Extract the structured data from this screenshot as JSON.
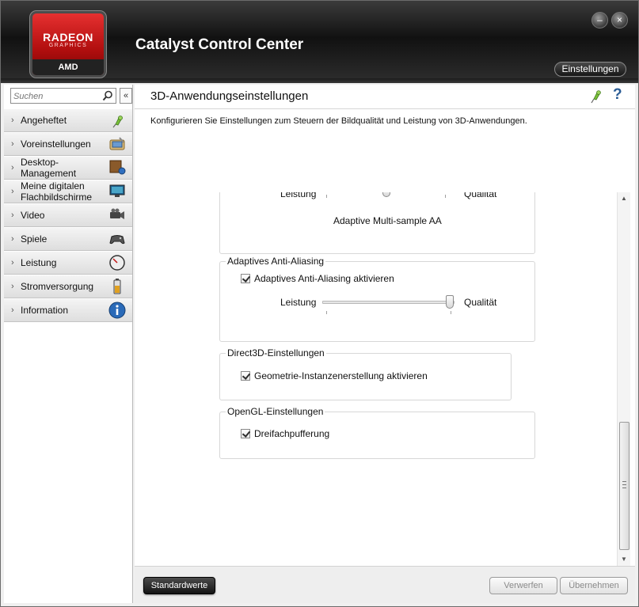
{
  "header": {
    "logo_top": "RADEON",
    "logo_sub": "GRAPHICS",
    "logo_brand": "AMD",
    "app_title": "Catalyst Control Center",
    "settings_label": "Einstellungen",
    "minimize_glyph": "–",
    "close_glyph": "×"
  },
  "sidebar": {
    "search_placeholder": "Suchen",
    "collapse_glyph": "«",
    "items": [
      {
        "label": "Angeheftet",
        "icon": "pin-icon"
      },
      {
        "label": "Voreinstellungen",
        "icon": "presets-icon"
      },
      {
        "label": "Desktop-\nManagement",
        "icon": "desktop-icon"
      },
      {
        "label": "Meine digitalen\nFlachbildschirme",
        "icon": "monitor-icon"
      },
      {
        "label": "Video",
        "icon": "video-camera-icon"
      },
      {
        "label": "Spiele",
        "icon": "gamepad-icon"
      },
      {
        "label": "Leistung",
        "icon": "gauge-icon"
      },
      {
        "label": "Stromversorgung",
        "icon": "battery-icon"
      },
      {
        "label": "Information",
        "icon": "info-icon"
      }
    ]
  },
  "content": {
    "title": "3D-Anwendungseinstellungen",
    "help_glyph": "?",
    "description": "Konfigurieren Sie Einstellungen zum Steuern der Bildqualität und Leistung von 3D-Anwendungen.",
    "aa_partial": {
      "left_label": "Leistung",
      "right_label": "Qualität",
      "caption": "Adaptive Multi-sample AA"
    },
    "adaptive_aa": {
      "title": "Adaptives Anti-Aliasing",
      "checkbox_label": "Adaptives Anti-Aliasing aktivieren",
      "checked": true,
      "left_label": "Leistung",
      "right_label": "Qualität",
      "slider_value": 1.0
    },
    "direct3d": {
      "title": "Direct3D-Einstellungen",
      "checkbox_label": "Geometrie-Instanzenerstellung aktivieren",
      "checked": true
    },
    "opengl": {
      "title": "OpenGL-Einstellungen",
      "checkbox_label": "Dreifachpufferung",
      "checked": true
    }
  },
  "footer": {
    "defaults_label": "Standardwerte",
    "discard_label": "Verwerfen",
    "apply_label": "Übernehmen"
  },
  "colors": {
    "accent_red": "#c41414",
    "help_blue": "#2a5c95"
  }
}
